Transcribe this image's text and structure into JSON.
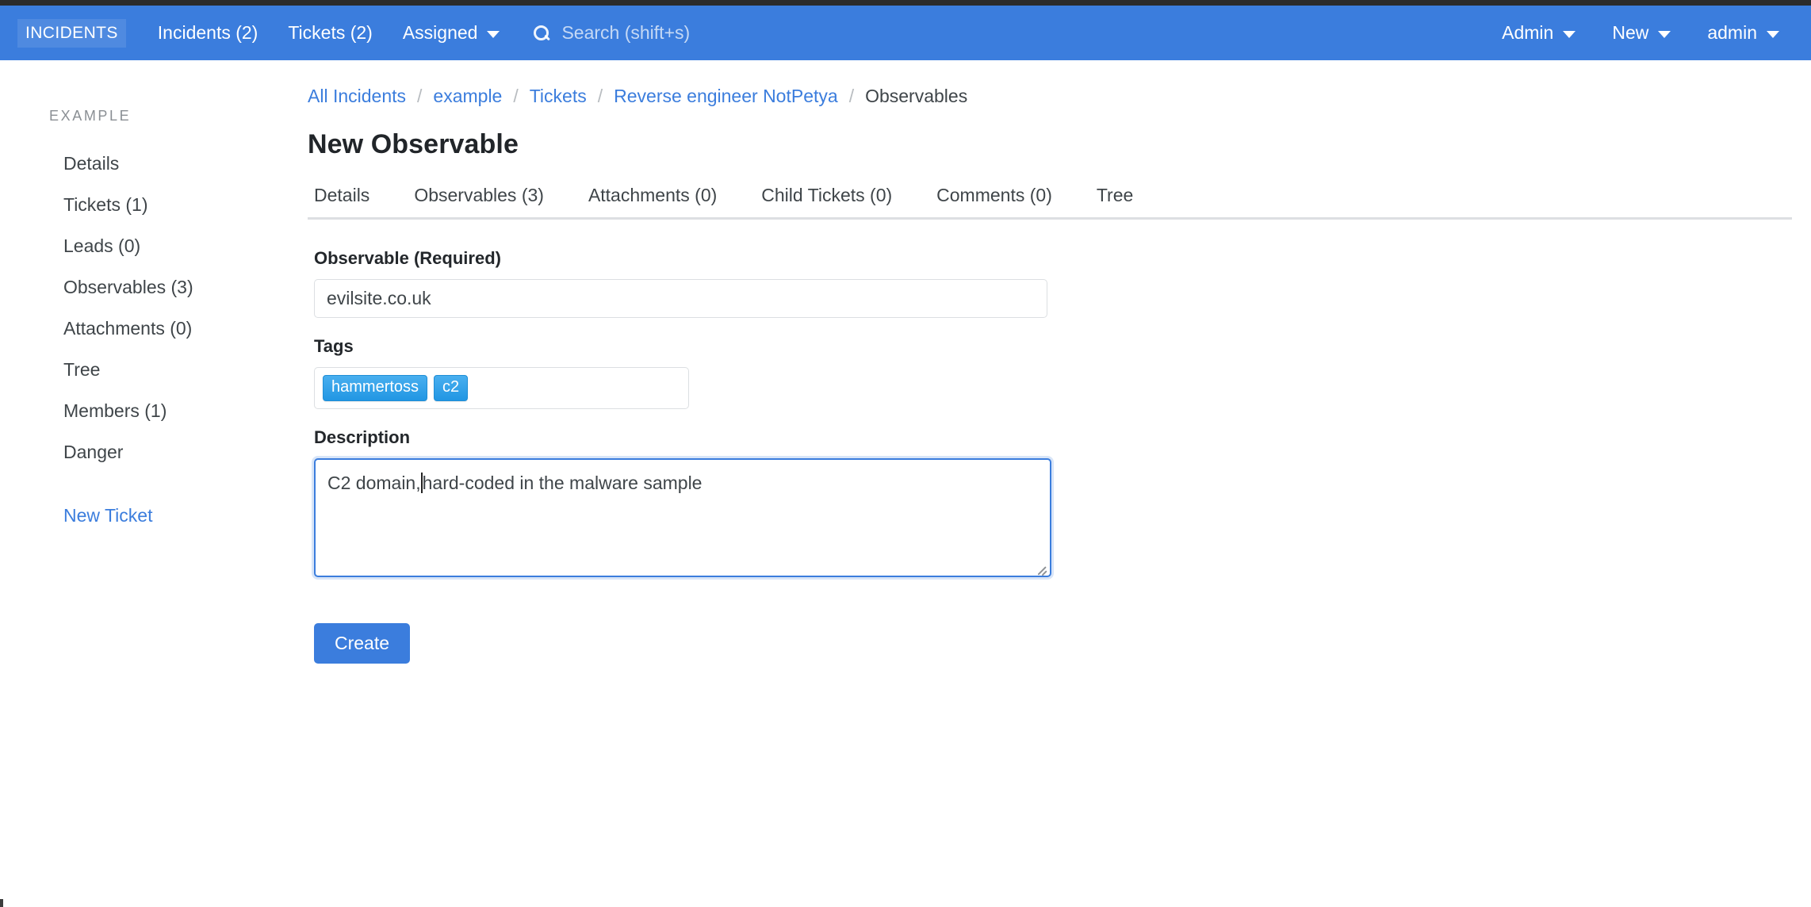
{
  "navbar": {
    "brand": "INCIDENTS",
    "left_links": [
      {
        "label": "Incidents (2)",
        "caret": false
      },
      {
        "label": "Tickets (2)",
        "caret": false
      },
      {
        "label": "Assigned",
        "caret": true
      }
    ],
    "search": {
      "icon": "search-icon",
      "placeholder": "Search (shift+s)"
    },
    "right_links": [
      {
        "label": "Admin",
        "caret": true
      },
      {
        "label": "New",
        "caret": true
      },
      {
        "label": "admin",
        "caret": true
      }
    ],
    "background_color": "#3b7ddd"
  },
  "sidebar": {
    "heading": "EXAMPLE",
    "items": [
      {
        "label": "Details"
      },
      {
        "label": "Tickets (1)"
      },
      {
        "label": "Leads (0)"
      },
      {
        "label": "Observables (3)"
      },
      {
        "label": "Attachments (0)"
      },
      {
        "label": "Tree"
      },
      {
        "label": "Members (1)"
      },
      {
        "label": "Danger"
      }
    ],
    "action_link": "New Ticket",
    "link_color": "#3b7ddd"
  },
  "breadcrumb": {
    "items": [
      {
        "label": "All Incidents",
        "current": false
      },
      {
        "label": "example",
        "current": false
      },
      {
        "label": "Tickets",
        "current": false
      },
      {
        "label": "Reverse engineer NotPetya",
        "current": false
      },
      {
        "label": "Observables",
        "current": true
      }
    ],
    "separator": "/"
  },
  "page_title": "New Observable",
  "tabs": [
    {
      "label": "Details",
      "active": false
    },
    {
      "label": "Observables (3)",
      "active": false
    },
    {
      "label": "Attachments (0)",
      "active": false
    },
    {
      "label": "Child Tickets (0)",
      "active": false
    },
    {
      "label": "Comments (0)",
      "active": false
    },
    {
      "label": "Tree",
      "active": false
    }
  ],
  "form": {
    "observable": {
      "label": "Observable (Required)",
      "value": "evilsite.co.uk",
      "placeholder": ""
    },
    "tags": {
      "label": "Tags",
      "chips": [
        "hammertoss",
        "c2"
      ],
      "chip_color": "#2196e3"
    },
    "description": {
      "label": "Description",
      "value_before_caret": "C2 domain,",
      "value_after_caret": "hard-coded in the malware sample",
      "full_value": "C2 domain,hard-coded in the malware sample",
      "focused": true,
      "focus_color": "#3b7ddd"
    },
    "submit_label": "Create"
  }
}
